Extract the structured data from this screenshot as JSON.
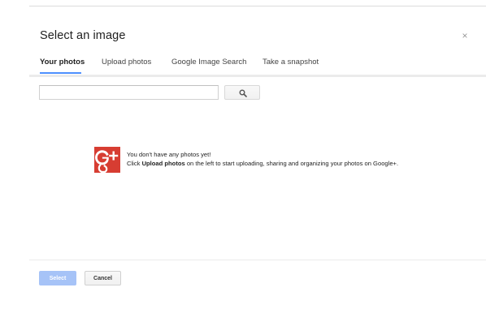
{
  "dialog": {
    "title": "Select an image",
    "close_glyph": "×"
  },
  "tabs": [
    {
      "label": "Your photos",
      "active": true
    },
    {
      "label": "Upload photos",
      "active": false
    },
    {
      "label": "Google Image Search",
      "active": false
    },
    {
      "label": "Take a snapshot",
      "active": false
    }
  ],
  "search": {
    "value": "",
    "placeholder": "",
    "button_icon": "search-icon"
  },
  "empty_state": {
    "logo_icon": "google-plus-logo",
    "line1": "You don't have any photos yet!",
    "line2_prefix": "Click ",
    "line2_bold": "Upload photos",
    "line2_suffix": " on the left to start uploading, sharing and organizing your photos on Google+."
  },
  "footer": {
    "select_label": "Select",
    "cancel_label": "Cancel"
  },
  "colors": {
    "accent": "#4d90fe",
    "select_disabled": "#a6c3f7",
    "google_plus_red": "#d73d32"
  }
}
